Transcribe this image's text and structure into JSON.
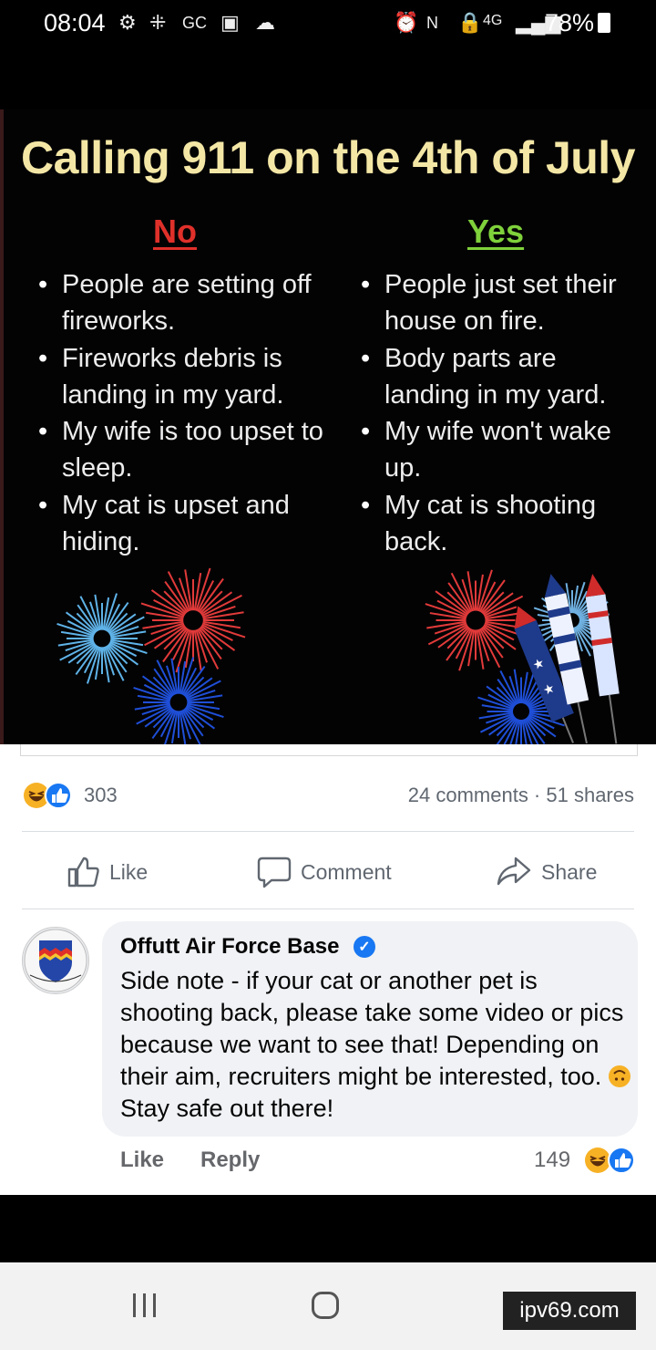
{
  "status_bar": {
    "time": "08:04",
    "network": "4G",
    "battery": "78%"
  },
  "post": {
    "image": {
      "title": "Calling 911 on the 4th of July",
      "no_label": "No",
      "yes_label": "Yes",
      "no_items": [
        "People are setting off fireworks.",
        "Fireworks debris is landing in my yard.",
        "My wife is too upset to sleep.",
        "My cat is upset and hiding."
      ],
      "yes_items": [
        "People just set their house on fire.",
        "Body parts are landing in my yard.",
        "My wife won't wake up.",
        "My cat is shooting back."
      ]
    },
    "reaction_count": "303",
    "stats": "24 comments · 51 shares",
    "actions": {
      "like": "Like",
      "comment": "Comment",
      "share": "Share"
    }
  },
  "comment": {
    "author": "Offutt Air Force Base",
    "text_before_emoji": "Side note - if your cat or another pet is shooting back, please take some video or pics because we want to see that! Depending on their aim, recruiters might be interested, too.",
    "text_after_emoji": " Stay safe out there!",
    "like_label": "Like",
    "reply_label": "Reply",
    "reaction_count": "149"
  },
  "watermark": "ipv69.com",
  "colors": {
    "title": "#f4e7a6",
    "no": "#e0302a",
    "yes": "#7fd13b",
    "facebook_blue": "#1877f2"
  }
}
